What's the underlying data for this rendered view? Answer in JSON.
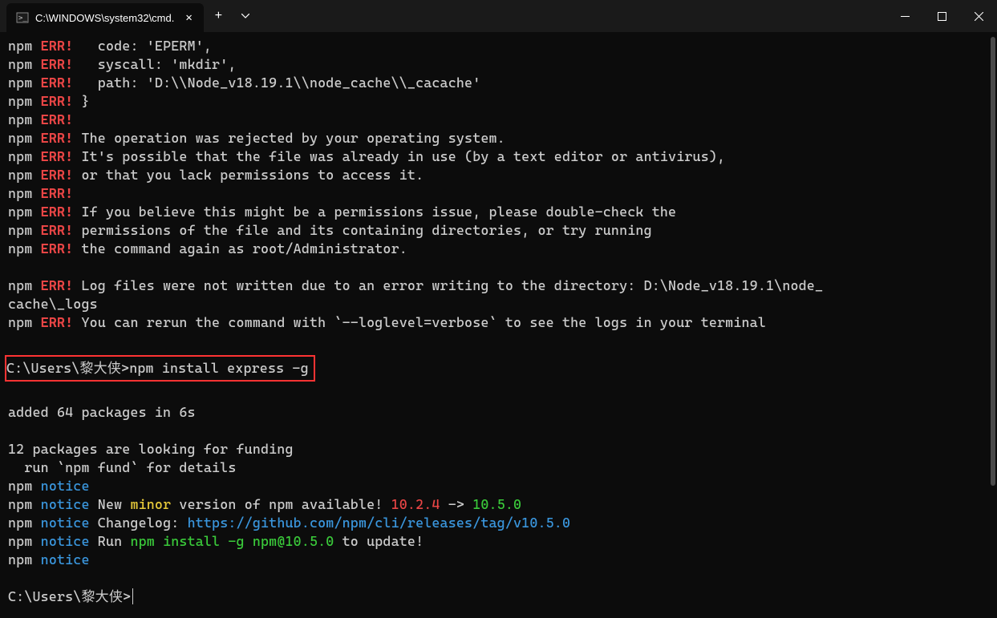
{
  "titlebar": {
    "tab_title": "C:\\WINDOWS\\system32\\cmd."
  },
  "lines": [
    {
      "prefix": "npm",
      "tag": "ERR!",
      "text": "   code: 'EPERM',"
    },
    {
      "prefix": "npm",
      "tag": "ERR!",
      "text": "   syscall: 'mkdir',"
    },
    {
      "prefix": "npm",
      "tag": "ERR!",
      "text": "   path: 'D:\\\\Node_v18.19.1\\\\node_cache\\\\_cacache'"
    },
    {
      "prefix": "npm",
      "tag": "ERR!",
      "text": " }"
    },
    {
      "prefix": "npm",
      "tag": "ERR!",
      "text": ""
    },
    {
      "prefix": "npm",
      "tag": "ERR!",
      "text": " The operation was rejected by your operating system."
    },
    {
      "prefix": "npm",
      "tag": "ERR!",
      "text": " It's possible that the file was already in use (by a text editor or antivirus),"
    },
    {
      "prefix": "npm",
      "tag": "ERR!",
      "text": " or that you lack permissions to access it."
    },
    {
      "prefix": "npm",
      "tag": "ERR!",
      "text": ""
    },
    {
      "prefix": "npm",
      "tag": "ERR!",
      "text": " If you believe this might be a permissions issue, please double-check the"
    },
    {
      "prefix": "npm",
      "tag": "ERR!",
      "text": " permissions of the file and its containing directories, or try running"
    },
    {
      "prefix": "npm",
      "tag": "ERR!",
      "text": " the command again as root/Administrator."
    }
  ],
  "log_lines": [
    {
      "prefix": "npm",
      "tag": "ERR!",
      "text": " Log files were not written due to an error writing to the directory: D:\\Node_v18.19.1\\node_"
    },
    {
      "raw": "cache\\_logs"
    },
    {
      "prefix": "npm",
      "tag": "ERR!",
      "text": " You can rerun the command with `--loglevel=verbose` to see the logs in your terminal"
    }
  ],
  "highlight": {
    "prompt": "C:\\Users\\黎大侠>",
    "command": "npm install express -g"
  },
  "post_install": [
    "added 64 packages in 6s",
    "",
    "12 packages are looking for funding",
    "  run `npm fund` for details"
  ],
  "notice_lines": {
    "blank1": " ",
    "new_minor_prefix": " New ",
    "minor_word": "minor",
    "new_minor_mid": " version of npm available! ",
    "old_version": "10.2.4",
    "arrow": " -> ",
    "new_version": "10.5.0",
    "changelog_prefix": " Changelog: ",
    "changelog_url": "https://github.com/npm/cli/releases/tag/v10.5.0",
    "run_prefix": " Run ",
    "install_command": "npm install -g npm@10.5.0",
    "run_suffix": " to update!",
    "blank2": " "
  },
  "final_prompt": "C:\\Users\\黎大侠>"
}
